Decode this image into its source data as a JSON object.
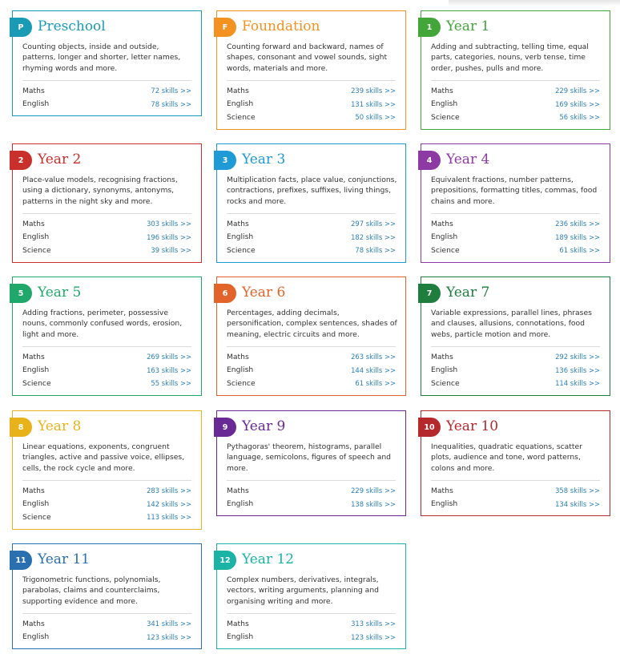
{
  "cards": [
    {
      "badge": "P",
      "title": "Preschool",
      "color": "#1a9bb5",
      "desc": "Counting objects, inside and outside, patterns, longer and shorter, letter names, rhyming words and more.",
      "subjects": [
        {
          "name": "Maths",
          "skills": "72 skills >>"
        },
        {
          "name": "English",
          "skills": "78 skills >>"
        }
      ]
    },
    {
      "badge": "F",
      "title": "Foundation",
      "color": "#f39220",
      "desc": "Counting forward and backward, names of shapes, consonant and vowel sounds, sight words, materials and more.",
      "subjects": [
        {
          "name": "Maths",
          "skills": "239 skills >>"
        },
        {
          "name": "English",
          "skills": "131 skills >>"
        },
        {
          "name": "Science",
          "skills": "50 skills >>"
        }
      ]
    },
    {
      "badge": "1",
      "title": "Year 1",
      "color": "#43a639",
      "desc": "Adding and subtracting, telling time, equal parts, categories, nouns, verb tense, time order, pushes, pulls and more.",
      "subjects": [
        {
          "name": "Maths",
          "skills": "229 skills >>"
        },
        {
          "name": "English",
          "skills": "169 skills >>"
        },
        {
          "name": "Science",
          "skills": "56 skills >>"
        }
      ]
    },
    {
      "badge": "2",
      "title": "Year 2",
      "color": "#c9302c",
      "desc": "Place-value models, recognising fractions, using a dictionary, synonyms, antonyms, patterns in the night sky and more.",
      "subjects": [
        {
          "name": "Maths",
          "skills": "303 skills >>"
        },
        {
          "name": "English",
          "skills": "196 skills >>"
        },
        {
          "name": "Science",
          "skills": "39 skills >>"
        }
      ]
    },
    {
      "badge": "3",
      "title": "Year 3",
      "color": "#1e9ad6",
      "desc": "Multiplication facts, place value, conjunctions, contractions, prefixes, suffixes, living things, rocks and more.",
      "subjects": [
        {
          "name": "Maths",
          "skills": "297 skills >>"
        },
        {
          "name": "English",
          "skills": "182 skills >>"
        },
        {
          "name": "Science",
          "skills": "78 skills >>"
        }
      ]
    },
    {
      "badge": "4",
      "title": "Year 4",
      "color": "#8e3aa5",
      "desc": "Equivalent fractions, number patterns, prepositions, formatting titles, commas, food chains and more.",
      "subjects": [
        {
          "name": "Maths",
          "skills": "236 skills >>"
        },
        {
          "name": "English",
          "skills": "189 skills >>"
        },
        {
          "name": "Science",
          "skills": "61 skills >>"
        }
      ]
    },
    {
      "badge": "5",
      "title": "Year 5",
      "color": "#20a86a",
      "desc": "Adding fractions, perimeter, possessive nouns, commonly confused words, erosion, light and more.",
      "subjects": [
        {
          "name": "Maths",
          "skills": "269 skills >>"
        },
        {
          "name": "English",
          "skills": "163 skills >>"
        },
        {
          "name": "Science",
          "skills": "55 skills >>"
        }
      ]
    },
    {
      "badge": "6",
      "title": "Year 6",
      "color": "#e2642a",
      "desc": "Percentages, adding decimals, personification, complex sentences, shades of meaning, electric circuits and more.",
      "subjects": [
        {
          "name": "Maths",
          "skills": "263 skills >>"
        },
        {
          "name": "English",
          "skills": "144 skills >>"
        },
        {
          "name": "Science",
          "skills": "61 skills >>"
        }
      ]
    },
    {
      "badge": "7",
      "title": "Year 7",
      "color": "#1f7d3e",
      "desc": "Variable expressions, parallel lines, phrases and clauses, allusions, connotations, food webs, particle motion and more.",
      "subjects": [
        {
          "name": "Maths",
          "skills": "292 skills >>"
        },
        {
          "name": "English",
          "skills": "136 skills >>"
        },
        {
          "name": "Science",
          "skills": "114 skills >>"
        }
      ]
    },
    {
      "badge": "8",
      "title": "Year 8",
      "color": "#e8b31a",
      "desc": "Linear equations, exponents, congruent triangles, active and passive voice, ellipses, cells, the rock cycle and more.",
      "subjects": [
        {
          "name": "Maths",
          "skills": "283 skills >>"
        },
        {
          "name": "English",
          "skills": "142 skills >>"
        },
        {
          "name": "Science",
          "skills": "113 skills >>"
        }
      ]
    },
    {
      "badge": "9",
      "title": "Year 9",
      "color": "#6a2a96",
      "desc": "Pythagoras' theorem, histograms, parallel language, semicolons, figures of speech and more.",
      "subjects": [
        {
          "name": "Maths",
          "skills": "229 skills >>"
        },
        {
          "name": "English",
          "skills": "138 skills >>"
        }
      ]
    },
    {
      "badge": "10",
      "title": "Year 10",
      "color": "#b5282c",
      "desc": "Inequalities, quadratic equations, scatter plots, audience and tone, word patterns, colons and more.",
      "subjects": [
        {
          "name": "Maths",
          "skills": "358 skills >>"
        },
        {
          "name": "English",
          "skills": "134 skills >>"
        }
      ]
    },
    {
      "badge": "11",
      "title": "Year 11",
      "color": "#2a6fb0",
      "desc": "Trigonometric functions, polynomials, parabolas, claims and counterclaims, supporting evidence and more.",
      "subjects": [
        {
          "name": "Maths",
          "skills": "341 skills >>"
        },
        {
          "name": "English",
          "skills": "123 skills >>"
        }
      ]
    },
    {
      "badge": "12",
      "title": "Year 12",
      "color": "#1ab3a6",
      "desc": "Complex numbers, derivatives, integrals, vectors, writing arguments, planning and organising writing and more.",
      "subjects": [
        {
          "name": "Maths",
          "skills": "313 skills >>"
        },
        {
          "name": "English",
          "skills": "123 skills >>"
        }
      ]
    }
  ]
}
